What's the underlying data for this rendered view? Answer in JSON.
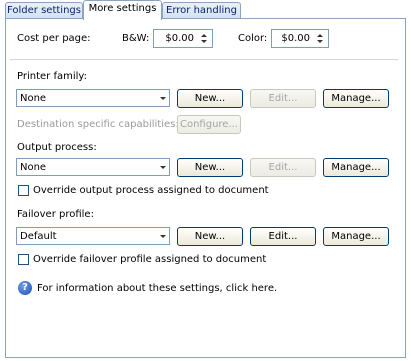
{
  "tabs": [
    {
      "label": "Folder settings"
    },
    {
      "label": "More settings"
    },
    {
      "label": "Error handling"
    }
  ],
  "cost": {
    "label": "Cost per page:",
    "bw_label": "B&W:",
    "bw_value": "$0.00",
    "color_label": "Color:",
    "color_value": "$0.00"
  },
  "printer_family": {
    "label": "Printer family:",
    "value": "None",
    "new": "New...",
    "edit": "Edit...",
    "manage": "Manage..."
  },
  "destination": {
    "label": "Destination specific capabilities:",
    "configure": "Configure..."
  },
  "output_process": {
    "label": "Output process:",
    "value": "None",
    "new": "New...",
    "edit": "Edit...",
    "manage": "Manage...",
    "override": "Override output process assigned to document"
  },
  "failover": {
    "label": "Failover profile:",
    "value": "Default",
    "new": "New...",
    "edit": "Edit...",
    "manage": "Manage...",
    "override": "Override failover profile assigned to document"
  },
  "info": "For information about these settings, click here."
}
